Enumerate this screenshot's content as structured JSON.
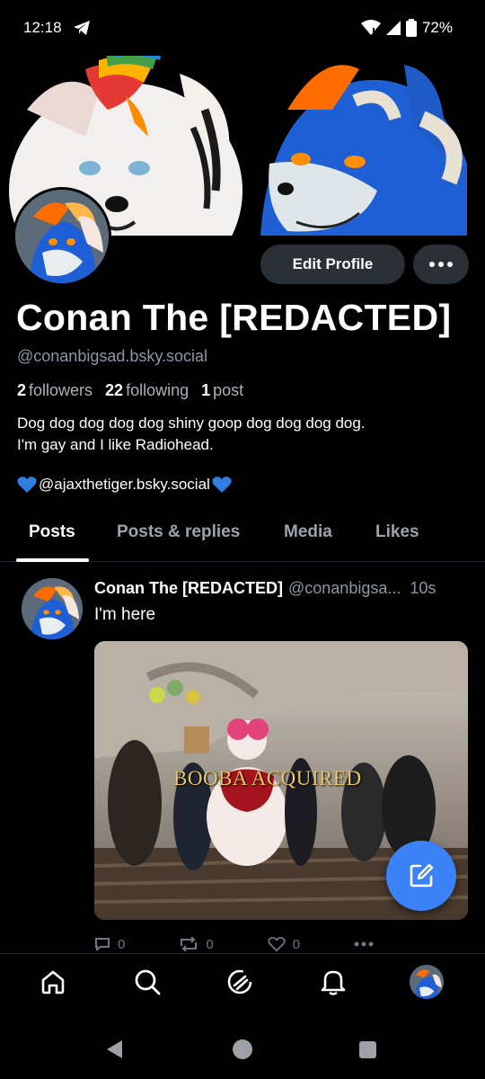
{
  "status_bar": {
    "time": "12:18",
    "battery": "72%",
    "icons": [
      "telegram-icon",
      "wifi-icon",
      "signal-icon",
      "battery-icon"
    ]
  },
  "profile": {
    "display_name": "Conan The [REDACTED]",
    "handle": "@conanbigsad.bsky.social",
    "followers_count": "2",
    "followers_label": "followers",
    "following_count": "22",
    "following_label": "following",
    "posts_count": "1",
    "posts_label": "post",
    "bio_line1": "Dog dog dog dog dog shiny goop dog dog dog dog.",
    "bio_line2": "I'm gay and I like Radiohead.",
    "bio_link_handle": "@ajaxthetiger.bsky.social",
    "edit_label": "Edit Profile"
  },
  "tabs": [
    {
      "label": "Posts",
      "active": true
    },
    {
      "label": "Posts & replies",
      "active": false
    },
    {
      "label": "Media",
      "active": false
    },
    {
      "label": "Likes",
      "active": false
    }
  ],
  "post": {
    "author": "Conan The [REDACTED]",
    "handle": "@conanbigsa...",
    "time": "10s",
    "text": "I'm here",
    "image_caption": "BOOBA ACQUIRED",
    "reply_count": "0",
    "repost_count": "0",
    "like_count": "0"
  },
  "colors": {
    "accent": "#3b82f6",
    "background": "#000000",
    "muted_text": "#8e96a3",
    "button_bg": "#2b2f36",
    "heart_blue": "#2f7fe0"
  },
  "nav": [
    "home-icon",
    "search-icon",
    "feeds-icon",
    "notifications-icon",
    "profile-avatar"
  ]
}
